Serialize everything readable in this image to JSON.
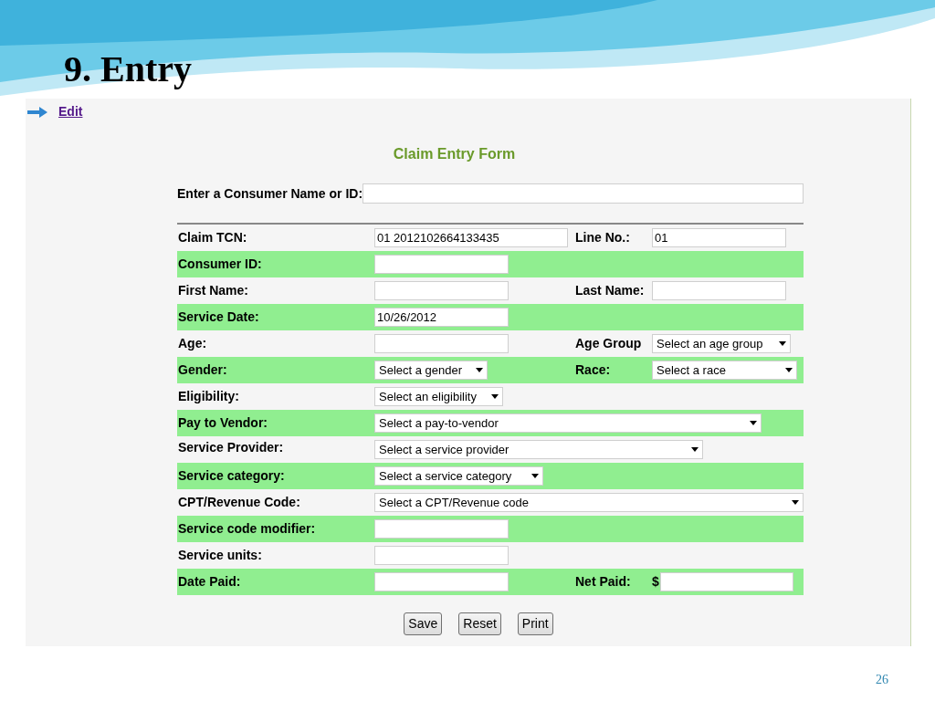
{
  "slide": {
    "title": "9. Entry",
    "page_number": "26"
  },
  "edit_link": "Edit",
  "form": {
    "title": "Claim Entry Form",
    "search": {
      "label": "Enter a Consumer Name or ID:"
    },
    "rows": [
      {
        "label": "Claim TCN:",
        "shaded": false,
        "control": {
          "kind": "text",
          "value": "01 2012102664133435"
        },
        "right": {
          "label": "Line No.:",
          "control": {
            "kind": "text",
            "value": "01"
          }
        }
      },
      {
        "label": "Consumer ID:",
        "shaded": true,
        "control": {
          "kind": "text"
        }
      },
      {
        "label": "First Name:",
        "shaded": false,
        "control": {
          "kind": "text"
        },
        "right": {
          "label": "Last Name:",
          "control": {
            "kind": "text"
          }
        }
      },
      {
        "label": "Service Date:",
        "shaded": true,
        "control": {
          "kind": "text",
          "value": "10/26/2012"
        }
      },
      {
        "label": "Age:",
        "shaded": false,
        "control": {
          "kind": "text"
        },
        "right": {
          "label": "Age Group",
          "control": {
            "kind": "select",
            "value": "Select an age group"
          }
        }
      },
      {
        "label": "Gender:",
        "shaded": true,
        "control": {
          "kind": "select",
          "value": "Select a gender"
        },
        "right": {
          "label": "Race:",
          "control": {
            "kind": "select",
            "value": "Select a race"
          }
        }
      },
      {
        "label": "Eligibility:",
        "shaded": false,
        "control": {
          "kind": "select",
          "value": "Select an eligibility"
        }
      },
      {
        "label": "Pay to Vendor:",
        "shaded": true,
        "control": {
          "kind": "select",
          "value": "Select a pay-to-vendor"
        }
      },
      {
        "label": "Service Provider:",
        "shaded": false,
        "control": {
          "kind": "select",
          "value": "Select a service provider"
        }
      },
      {
        "label": "Service category:",
        "shaded": true,
        "control": {
          "kind": "select",
          "value": "Select a service category"
        }
      },
      {
        "label": "CPT/Revenue Code:",
        "shaded": false,
        "control": {
          "kind": "select",
          "value": "Select a CPT/Revenue code"
        }
      },
      {
        "label": "Service code modifier:",
        "shaded": true,
        "control": {
          "kind": "text"
        }
      },
      {
        "label": "Service units:",
        "shaded": false,
        "control": {
          "kind": "text"
        }
      },
      {
        "label": "Date Paid:",
        "shaded": true,
        "control": {
          "kind": "text"
        },
        "right": {
          "label": "Net Paid:",
          "prefix": "$",
          "control": {
            "kind": "text"
          }
        }
      }
    ],
    "buttons": [
      "Save",
      "Reset",
      "Print"
    ]
  }
}
